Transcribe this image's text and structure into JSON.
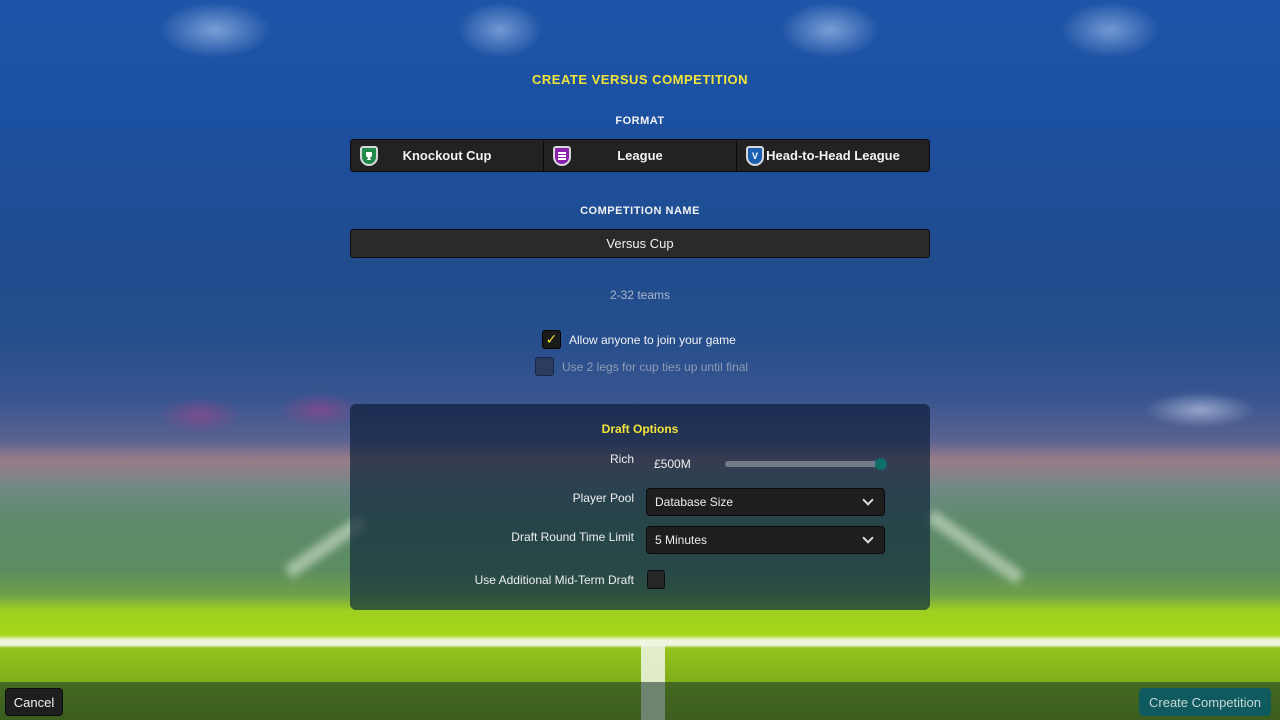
{
  "header": {
    "title": "CREATE VERSUS COMPETITION"
  },
  "format": {
    "label": "FORMAT",
    "options": [
      {
        "label": "Knockout Cup",
        "icon": "trophy-shield-icon",
        "color": "#1f8a4a",
        "glyph": "🏆"
      },
      {
        "label": "League",
        "icon": "table-shield-icon",
        "color": "#8a22b0",
        "glyph": "≣"
      },
      {
        "label": "Head-to-Head League",
        "icon": "versus-shield-icon",
        "color": "#1a5fb0",
        "glyph": "V"
      }
    ]
  },
  "competition_name": {
    "label": "COMPETITION NAME",
    "value": "Versus Cup"
  },
  "teams_info": "2-32 teams",
  "options": {
    "allow_join": {
      "label": "Allow anyone to join your game",
      "checked": true,
      "glyph": "✓"
    },
    "two_legs": {
      "label": "Use 2 legs for cup ties up until final",
      "checked": false,
      "disabled": true
    }
  },
  "draft": {
    "title": "Draft Options",
    "budget": {
      "label": "Rich",
      "value": "£500M",
      "slider_fraction": 1.0
    },
    "player_pool": {
      "label": "Player Pool",
      "selected": "Database Size"
    },
    "round_time": {
      "label": "Draft Round Time Limit",
      "selected": "5 Minutes"
    },
    "mid_term": {
      "label": "Use Additional Mid-Term Draft",
      "checked": false
    }
  },
  "footer": {
    "cancel_label": "Cancel",
    "create_label": "Create Competition"
  },
  "colors": {
    "accent_yellow": "#f2e43a",
    "create_button": "#0e5a5e",
    "slider_thumb": "#0f6f6a"
  }
}
